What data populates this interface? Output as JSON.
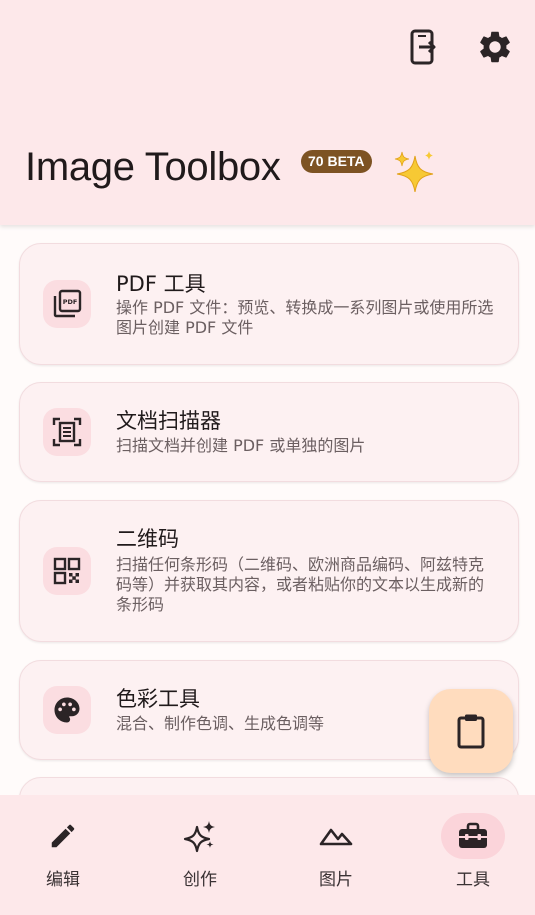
{
  "header": {
    "title": "Image Toolbox",
    "version_badge": "70 BETA",
    "share_icon": "phone-share-icon",
    "settings_icon": "gear-icon",
    "sparkle_icon": "sparkles-icon"
  },
  "tools": [
    {
      "title": "PDF 工具",
      "description": "操作 PDF 文件：预览、转换成一系列图片或使用所选图片创建 PDF 文件",
      "icon": "pdf-icon"
    },
    {
      "title": "文档扫描器",
      "description": "扫描文档并创建 PDF 或单独的图片",
      "icon": "document-scanner-icon"
    },
    {
      "title": "二维码",
      "description": "扫描任何条形码（二维码、欧洲商品编码、阿兹特克码等）并获取其内容，或者粘贴你的文本以生成新的条形码",
      "icon": "qr-code-icon"
    },
    {
      "title": "色彩工具",
      "description": "混合、制作色调、生成色调等",
      "icon": "palette-icon"
    }
  ],
  "fab": {
    "icon": "clipboard-icon"
  },
  "nav": [
    {
      "label": "编辑",
      "icon": "pencil-icon"
    },
    {
      "label": "创作",
      "icon": "sparkles-icon"
    },
    {
      "label": "图片",
      "icon": "landscape-icon"
    },
    {
      "label": "工具",
      "icon": "toolbox-icon",
      "active": true
    }
  ],
  "colors": {
    "surface": "#fde8ea",
    "background": "#fffbfa",
    "card": "#fdf1f2",
    "icon_container": "#fbdde1",
    "badge": "#7d5323",
    "fab": "#ffdcbe",
    "nav_active": "#fbd4da"
  }
}
